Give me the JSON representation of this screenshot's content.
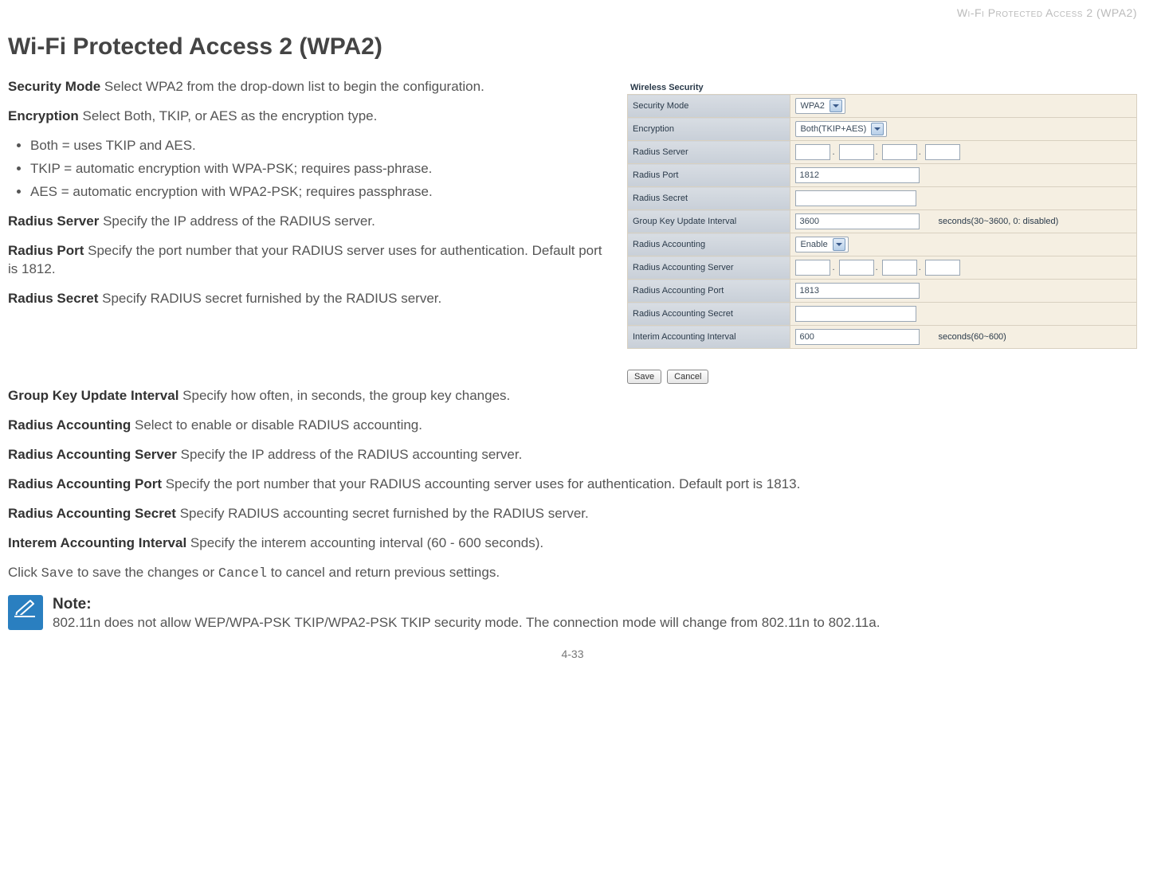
{
  "header_right": "Wi-Fi Protected Access 2 (WPA2)",
  "page_title": "Wi-Fi Protected Access 2 (WPA2)",
  "paras": {
    "security_mode": {
      "label": "Security Mode",
      "text": "  Select WPA2 from the drop-down list to begin the configuration."
    },
    "encryption": {
      "label": "Encryption",
      "text": "  Select Both, TKIP, or AES as the encryption type."
    },
    "bullets": [
      "Both = uses TKIP and AES.",
      "TKIP = automatic encryption with WPA-PSK; requires pass-phrase.",
      "AES = automatic encryption with WPA2-PSK; requires passphrase."
    ],
    "radius_server": {
      "label": "Radius Server",
      "text": "  Specify the IP address of the RADIUS server."
    },
    "radius_port": {
      "label": "Radius Port",
      "text": "  Specify the port number that your RADIUS server uses for authentication. Default port is 1812."
    },
    "radius_secret": {
      "label": "Radius Secret",
      "text": "  Specify RADIUS secret furnished by the RADIUS server."
    },
    "group_key": {
      "label": "Group Key Update Interval",
      "text": "  Specify how often, in seconds, the group key changes."
    },
    "radius_acct": {
      "label": "Radius Accounting",
      "text": "  Select to enable or disable RADIUS accounting."
    },
    "radius_acct_server": {
      "label": "Radius Accounting Server",
      "text": "  Specify the IP address of the RADIUS accounting server."
    },
    "radius_acct_port": {
      "label": "Radius Accounting Port",
      "text": "  Specify the port number that your RADIUS accounting server uses for authentication. Default port is 1813."
    },
    "radius_acct_secret": {
      "label": "Radius Accounting Secret",
      "text": "  Specify RADIUS accounting secret furnished by the RADIUS server."
    },
    "interim": {
      "label": "Interem Accounting Interval",
      "text": "  Specify the interem accounting interval (60 - 600 seconds)."
    },
    "click_pre": "Click ",
    "save_code": "Save",
    "click_mid": " to save the changes or ",
    "cancel_code": "Cancel",
    "click_post": " to cancel and return previous settings."
  },
  "shot": {
    "title": "Wireless Security",
    "rows": {
      "security_mode": {
        "label": "Security Mode",
        "value": "WPA2"
      },
      "encryption": {
        "label": "Encryption",
        "value": "Both(TKIP+AES)"
      },
      "radius_server": {
        "label": "Radius Server"
      },
      "radius_port": {
        "label": "Radius Port",
        "value": "1812"
      },
      "radius_secret": {
        "label": "Radius Secret"
      },
      "group_key": {
        "label": "Group Key Update Interval",
        "value": "3600",
        "hint": "seconds(30~3600, 0: disabled)"
      },
      "radius_acct": {
        "label": "Radius Accounting",
        "value": "Enable"
      },
      "radius_acct_server": {
        "label": "Radius Accounting Server"
      },
      "radius_acct_port": {
        "label": "Radius Accounting Port",
        "value": "1813"
      },
      "radius_acct_secret": {
        "label": "Radius Accounting Secret"
      },
      "interim": {
        "label": "Interim Accounting Interval",
        "value": "600",
        "hint": "seconds(60~600)"
      }
    },
    "save_btn": "Save",
    "cancel_btn": "Cancel"
  },
  "note": {
    "title": "Note:",
    "text": "802.11n does not allow WEP/WPA-PSK TKIP/WPA2-PSK TKIP security mode. The connection mode will change from 802.11n to 802.11a."
  },
  "footer": "4-33"
}
